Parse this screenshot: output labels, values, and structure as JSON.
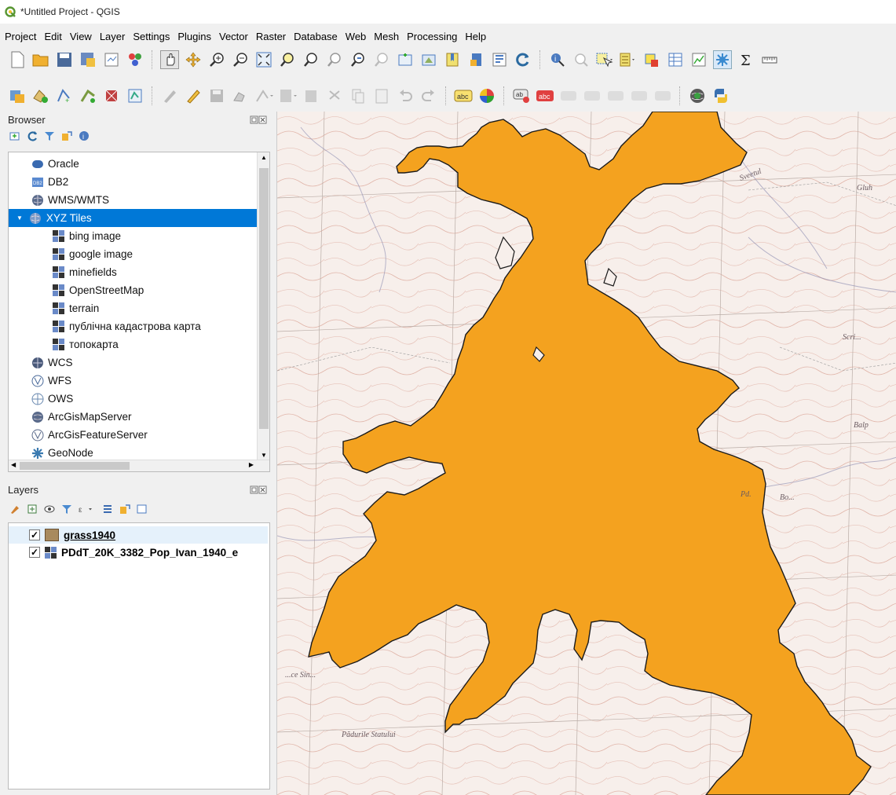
{
  "window": {
    "title": "*Untitled Project - QGIS"
  },
  "menu": [
    "Project",
    "Edit",
    "View",
    "Layer",
    "Settings",
    "Plugins",
    "Vector",
    "Raster",
    "Database",
    "Web",
    "Mesh",
    "Processing",
    "Help"
  ],
  "browser": {
    "title": "Browser",
    "items": [
      {
        "label": "Oracle",
        "icon": "oracle-icon",
        "indent": 0
      },
      {
        "label": "DB2",
        "icon": "db2-icon",
        "indent": 0
      },
      {
        "label": "WMS/WMTS",
        "icon": "wms-icon",
        "indent": 0
      },
      {
        "label": "XYZ Tiles",
        "icon": "xyz-icon",
        "indent": 0,
        "selected": true,
        "expanded": true
      },
      {
        "label": "bing image",
        "icon": "tile-icon",
        "indent": 1
      },
      {
        "label": "google image",
        "icon": "tile-icon",
        "indent": 1
      },
      {
        "label": "minefields",
        "icon": "tile-icon",
        "indent": 1
      },
      {
        "label": "OpenStreetMap",
        "icon": "tile-icon",
        "indent": 1
      },
      {
        "label": "terrain",
        "icon": "tile-icon",
        "indent": 1
      },
      {
        "label": "публічна кадастрова карта",
        "icon": "tile-icon",
        "indent": 1
      },
      {
        "label": "топокарта",
        "icon": "tile-icon",
        "indent": 1
      },
      {
        "label": "WCS",
        "icon": "wcs-icon",
        "indent": 0
      },
      {
        "label": "WFS",
        "icon": "wfs-icon",
        "indent": 0
      },
      {
        "label": "OWS",
        "icon": "ows-icon",
        "indent": 0
      },
      {
        "label": "ArcGisMapServer",
        "icon": "arcgis-map-icon",
        "indent": 0
      },
      {
        "label": "ArcGisFeatureServer",
        "icon": "arcgis-feature-icon",
        "indent": 0
      },
      {
        "label": "GeoNode",
        "icon": "geonode-icon",
        "indent": 0
      }
    ]
  },
  "layers": {
    "title": "Layers",
    "items": [
      {
        "label": "grass1940",
        "checked": true,
        "icon": "polygon-fill-swatch",
        "swatch": "#a88a5e"
      },
      {
        "label": "PDdT_20K_3382_Pop_Ivan_1940_e",
        "checked": true,
        "icon": "raster-icon"
      }
    ]
  },
  "map": {
    "polygon_fill": "#f4a21f",
    "base_color": "#f5ece8"
  }
}
